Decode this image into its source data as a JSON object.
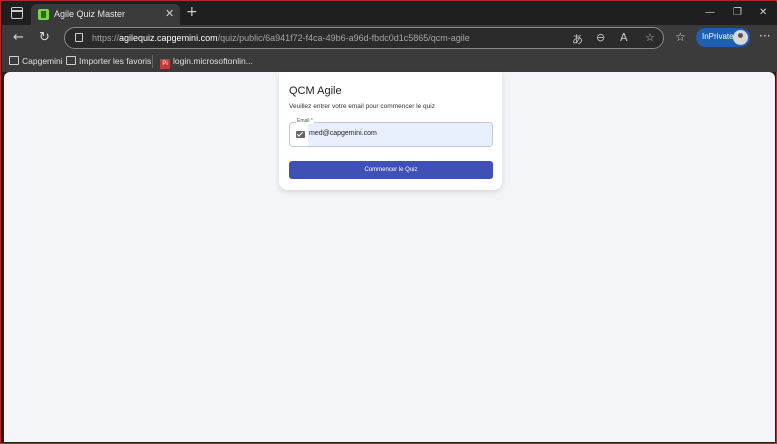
{
  "browser": {
    "tab_title": "Agile Quiz Master",
    "url_prefix": "https://",
    "url_host": "agilequiz.capgemini.com",
    "url_path": "/quiz/public/6a941f72-f4ca-49b6-a96d-fbdc0d1c5865/qcm-agile",
    "inprivate_label": "InPrivate"
  },
  "bookmarks": [
    {
      "label": "Capgemini"
    },
    {
      "label": "Importer les favoris"
    },
    {
      "label": "login.microsoftonlin..."
    }
  ],
  "quiz": {
    "title": "QCM Agile",
    "subtitle": "Veuillez entrer votre email pour commencer le quiz",
    "email_label": "Email *",
    "email_value": "med@capgemini.com",
    "start_button": "Commencer le Quiz"
  },
  "icons": {
    "tab_favicon": "agile-quiz-favicon-icon",
    "lock": "lock-icon",
    "mail": "mail-icon"
  },
  "colors": {
    "accent_button": "#3f51b5",
    "inprivate": "#1e5fb3",
    "frame_border": "#b12a2a",
    "autofill": "#e8f0fe"
  }
}
